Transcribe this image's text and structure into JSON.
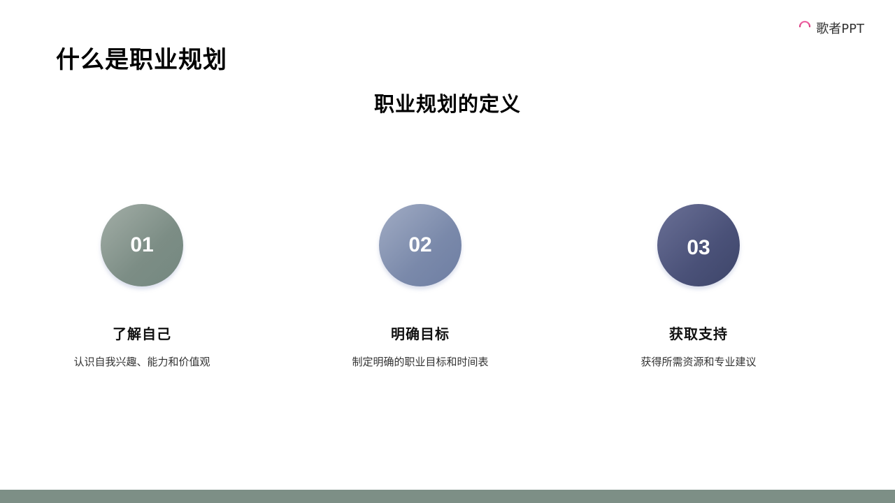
{
  "brand": {
    "logo_text": "歌者PPT",
    "logo_icon": "microphone-wave-icon",
    "accent_color": "#e3418e"
  },
  "slide": {
    "title": "什么是职业规划",
    "section_title": "职业规划的定义"
  },
  "cards": [
    {
      "number": "01",
      "title": "了解自己",
      "description": "认识自我兴趣、能力和价值观",
      "color": "#7c8d85"
    },
    {
      "number": "02",
      "title": "明确目标",
      "description": "制定明确的职业目标和时间表",
      "color": "#7a89aa"
    },
    {
      "number": "03",
      "title": "获取支持",
      "description": "获得所需资源和专业建议",
      "color": "#4a5178"
    }
  ],
  "footer": {
    "bar_color": "#7d8f86"
  }
}
